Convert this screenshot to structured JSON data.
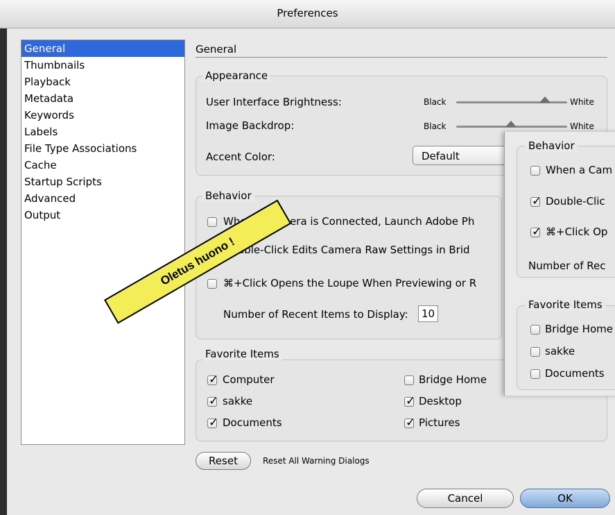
{
  "window": {
    "title": "Preferences"
  },
  "sidebar": {
    "items": [
      {
        "label": "General",
        "selected": true
      },
      {
        "label": "Thumbnails"
      },
      {
        "label": "Playback"
      },
      {
        "label": "Metadata"
      },
      {
        "label": "Keywords"
      },
      {
        "label": "Labels"
      },
      {
        "label": "File Type Associations"
      },
      {
        "label": "Cache"
      },
      {
        "label": "Startup Scripts"
      },
      {
        "label": "Advanced"
      },
      {
        "label": "Output"
      }
    ]
  },
  "page": {
    "title": "General"
  },
  "appearance": {
    "legend": "Appearance",
    "brightness": {
      "label": "User Interface Brightness:",
      "min_label": "Black",
      "max_label": "White",
      "level": 0.85
    },
    "backdrop": {
      "label": "Image Backdrop:",
      "min_label": "Black",
      "max_label": "White",
      "level": 0.53
    },
    "accent": {
      "label": "Accent Color:",
      "value": "Default"
    }
  },
  "behavior": {
    "legend": "Behavior",
    "camera": {
      "label": "When a Camera is Connected, Launch Adobe Ph",
      "checked": false
    },
    "double_click": {
      "label": "Double-Click Edits Camera Raw Settings in Brid",
      "checked": false
    },
    "cmd_click": {
      "label": "⌘+Click Opens the Loupe When Previewing or R",
      "checked": false
    },
    "recent": {
      "label": "Number of Recent Items to Display:",
      "value": "10"
    }
  },
  "favorites": {
    "legend": "Favorite Items",
    "items": [
      {
        "label": "Computer",
        "checked": true
      },
      {
        "label": "Bridge Home",
        "checked": false
      },
      {
        "label": "sakke",
        "checked": true
      },
      {
        "label": "Desktop",
        "checked": true
      },
      {
        "label": "Documents",
        "checked": true
      },
      {
        "label": "Pictures",
        "checked": true
      }
    ]
  },
  "reset": {
    "button_label": "Reset",
    "description": "Reset All Warning Dialogs"
  },
  "footer": {
    "cancel_label": "Cancel",
    "ok_label": "OK"
  },
  "overlay": {
    "behavior_legend": "Behavior",
    "camera_label": "When a Cam",
    "double_click_label": "Double-Clic",
    "cmd_click_label": "⌘+Click Op",
    "recent_label": "Number of Rec",
    "favorites_legend": "Favorite Items",
    "fav_items": [
      {
        "label": "Bridge Home",
        "checked": false
      },
      {
        "label": "sakke",
        "checked": false
      },
      {
        "label": "Documents",
        "checked": false
      }
    ],
    "double_click_checked": true,
    "cmd_click_checked": true,
    "camera_checked": false
  },
  "annotation": {
    "text": "Oletus huono !",
    "color": "#f3ee58"
  },
  "colors": {
    "selection": "#2f67dc",
    "ok_button": "#7fa8d8"
  }
}
